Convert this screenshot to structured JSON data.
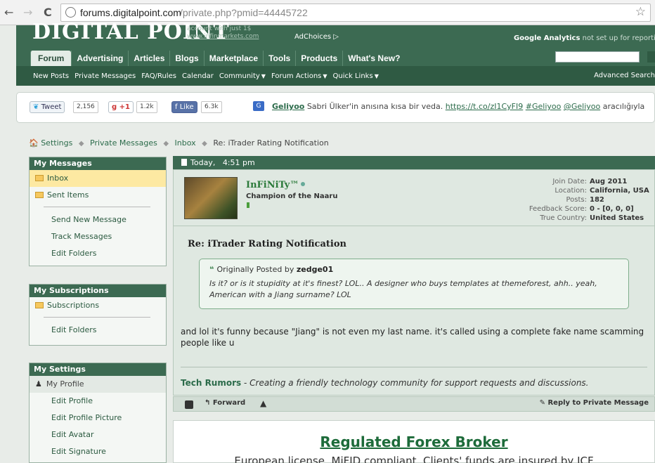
{
  "browser": {
    "url_host": "forums.digitalpoint.com",
    "url_path": "/private.php?pmid=44445722"
  },
  "header": {
    "logo": "DIGITAL POINT",
    "ad_line1": "account with just 1$",
    "ad_line2": "www.infinmarkets.com",
    "adchoices": "AdChoices ▷",
    "ga_bold": "Google Analytics",
    "ga_rest": "not set up for reporting",
    "tabs": [
      "Forum",
      "Advertising",
      "Articles",
      "Blogs",
      "Marketplace",
      "Tools",
      "Products",
      "What's New?"
    ],
    "subnav": [
      "New Posts",
      "Private Messages",
      "FAQ/Rules",
      "Calendar",
      "Community",
      "Forum Actions",
      "Quick Links"
    ],
    "advanced_search": "Advanced Search"
  },
  "share": {
    "tweet": "Tweet",
    "tweet_count": "2,156",
    "gplus": "+1",
    "gplus_count": "1.2k",
    "like": "Like",
    "like_count": "6.3k",
    "tweet_user": "Geliyoo",
    "tweet_text": "Sabri Ülker'in anısına kısa bir veda.",
    "tweet_link": "https://t.co/zI1CyFI9",
    "tweet_hashtag": "#Geliyoo",
    "tweet_mention": "@Geliyoo",
    "tweet_suffix": "aracılığıyla"
  },
  "breadcrumb": [
    "Settings",
    "Private Messages",
    "Inbox",
    "Re: iTrader Rating Notification"
  ],
  "sidebar": {
    "messages": {
      "title": "My Messages",
      "folders": [
        "Inbox",
        "Sent Items"
      ],
      "links": [
        "Send New Message",
        "Track Messages",
        "Edit Folders"
      ]
    },
    "subscriptions": {
      "title": "My Subscriptions",
      "folders": [
        "Subscriptions"
      ],
      "links": [
        "Edit Folders"
      ]
    },
    "settings": {
      "title": "My Settings",
      "profile": "My Profile",
      "links": [
        "Edit Profile",
        "Edit Profile Picture",
        "Edit Avatar",
        "Edit Signature"
      ]
    }
  },
  "post": {
    "date": "Today,",
    "time": "4:51 pm",
    "username": "InFiNiTy™",
    "usertitle": "Champion of the Naaru",
    "stats": [
      {
        "label": "Join Date:",
        "value": "Aug 2011"
      },
      {
        "label": "Location:",
        "value": "California, USA"
      },
      {
        "label": "Posts:",
        "value": "182"
      },
      {
        "label": "Feedback Score:",
        "value": "0 - [0, 0, 0]"
      },
      {
        "label": "True Country:",
        "value": "United States"
      }
    ],
    "title": "Re: iTrader Rating Notification",
    "quote_prefix": "Originally Posted by",
    "quote_author": "zedge01",
    "quote_text": "Is it? or is it stupidity at it's finest? LOL.. A designer who buys templates at themeforest, ahh.. yeah, American with a Jiang surname? LOL",
    "message": "and lol it's funny because \"Jiang\" is not even my last name. it's called using a complete fake name scamming people like u",
    "sig_bold": "Tech Rumors",
    "sig_dash": " - ",
    "sig_italic": "Creating a friendly technology community for support requests and discussions.",
    "forward": "Forward",
    "reply": "Reply to Private Message"
  },
  "ad": {
    "title": "Regulated Forex Broker",
    "text": "European license, MiFID compliant, Clients' funds are insured by ICF"
  }
}
